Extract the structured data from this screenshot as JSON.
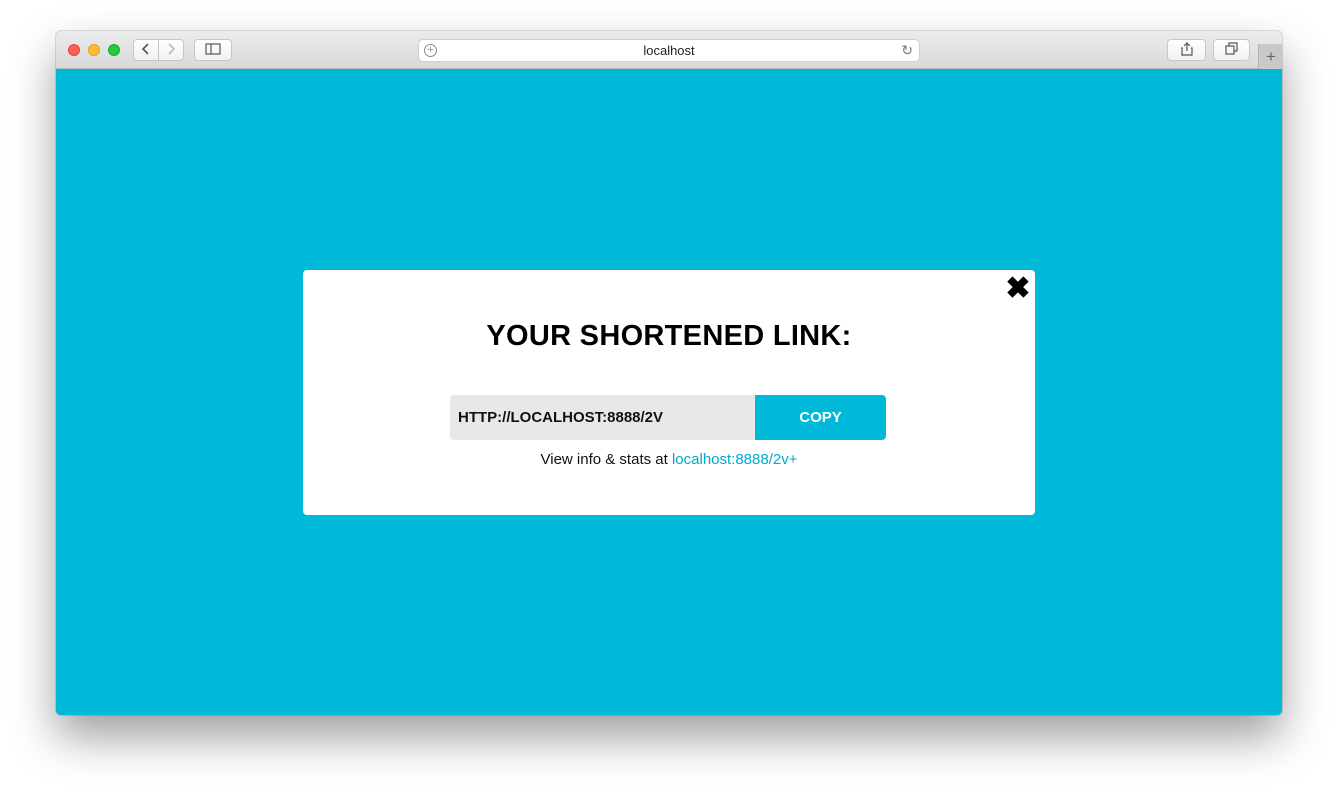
{
  "browser": {
    "url": "localhost",
    "icons": {
      "back": "chevron-left-icon",
      "forward": "chevron-right-icon",
      "sidebar": "sidebar-icon",
      "share": "share-icon",
      "tabs": "tabs-icon",
      "new_tab": "plus-icon",
      "reload": "reload-icon",
      "url_left": "plus-circle-icon"
    }
  },
  "modal": {
    "title": "YOUR SHORTENED LINK:",
    "short_link": "HTTP://LOCALHOST:8888/2V",
    "copy_label": "COPY",
    "stats_prefix": "View info & stats at",
    "stats_link": "localhost:8888/2v+"
  },
  "colors": {
    "background": "#00b9d9",
    "accent": "#00b9d9",
    "link": "#00a9cf"
  }
}
